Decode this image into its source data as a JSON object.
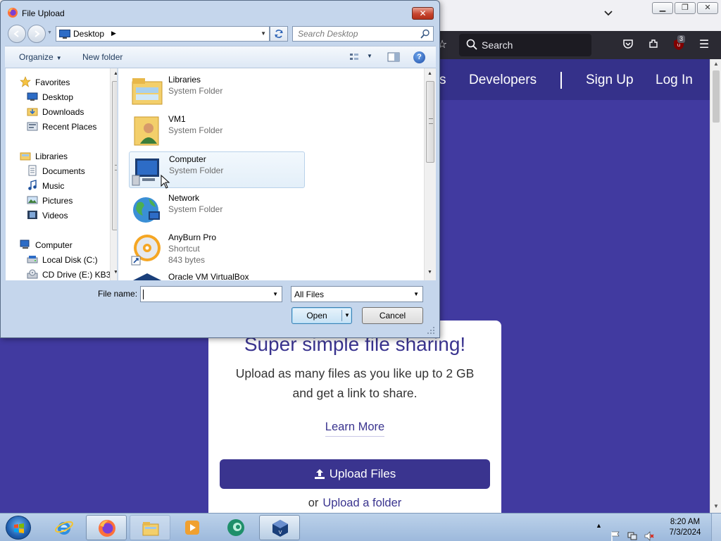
{
  "browser": {
    "toolbar_search_placeholder": "Search",
    "ublock_badge": "3"
  },
  "site": {
    "nav": {
      "partial_left": "s",
      "developers": "Developers",
      "signup": "Sign Up",
      "login": "Log In"
    },
    "card": {
      "title": "Super simple file sharing!",
      "subtitle_line1": "Upload as many files as you like up to 2 GB",
      "subtitle_line2": "and get a link to share.",
      "learn_more": "Learn More",
      "upload_files": "Upload Files",
      "or": "or",
      "upload_folder": "Upload a folder"
    },
    "colors": {
      "header": "#35318a",
      "body": "#413aa0",
      "accent": "#3a348f"
    }
  },
  "dialog": {
    "title": "File Upload",
    "close_label": "✕",
    "address": "Desktop",
    "search_placeholder": "Search Desktop",
    "organize": "Organize",
    "new_folder": "New folder",
    "help": "?",
    "nav_pane": {
      "favorites": "Favorites",
      "desktop": "Desktop",
      "downloads": "Downloads",
      "recent_places": "Recent Places",
      "libraries": "Libraries",
      "documents": "Documents",
      "music": "Music",
      "pictures": "Pictures",
      "videos": "Videos",
      "computer": "Computer",
      "local_disk": "Local Disk (C:)",
      "cd_drive": "CD Drive (E:) KB3"
    },
    "files": [
      {
        "name": "Libraries",
        "type": "System Folder",
        "icon": "libraries-folder-icon"
      },
      {
        "name": "VM1",
        "type": "System Folder",
        "icon": "user-folder-icon"
      },
      {
        "name": "Computer",
        "type": "System Folder",
        "icon": "computer-icon"
      },
      {
        "name": "Network",
        "type": "System Folder",
        "icon": "network-icon"
      },
      {
        "name": "AnyBurn Pro",
        "type": "Shortcut",
        "size": "843 bytes",
        "icon": "anyburn-icon"
      },
      {
        "name": "Oracle VM VirtualBox",
        "icon": "virtualbox-icon"
      }
    ],
    "filename_label": "File name:",
    "filename_value": "",
    "filetype": "All Files",
    "open": "Open",
    "cancel": "Cancel"
  },
  "taskbar": {
    "time": "8:20 AM",
    "date": "7/3/2024"
  }
}
